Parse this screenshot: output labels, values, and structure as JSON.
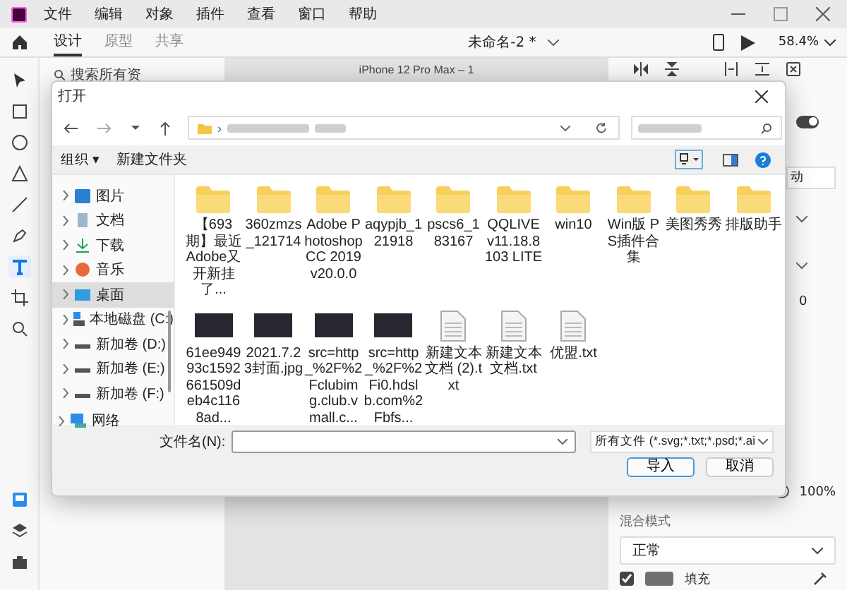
{
  "app": {
    "menu": [
      "文件",
      "编辑",
      "对象",
      "插件",
      "查看",
      "窗口",
      "帮助"
    ],
    "tabs": [
      {
        "label": "设计",
        "selected": true
      },
      {
        "label": "原型",
        "selected": false
      },
      {
        "label": "共享",
        "selected": false
      }
    ],
    "document_title": "未命名-2 *",
    "zoom": "58.4%",
    "tools": [
      {
        "kind": "select",
        "selected": false
      },
      {
        "kind": "rect",
        "selected": false
      },
      {
        "kind": "ellipse",
        "selected": false
      },
      {
        "kind": "triangle",
        "selected": false
      },
      {
        "kind": "line",
        "selected": false
      },
      {
        "kind": "pen",
        "selected": false
      },
      {
        "kind": "text",
        "selected": true
      },
      {
        "kind": "artboard",
        "selected": false
      },
      {
        "kind": "zoom",
        "selected": false
      }
    ],
    "assets_search": {
      "placeholder": "搜索所有资"
    },
    "artboard_label": "iPhone 12 Pro Max – 1",
    "right_panel": {
      "toggle_on": true,
      "field_fragment": "动",
      "value_fragment": "0",
      "opacity": "100%",
      "opacity_slider": {
        "level": 1
      },
      "blend_label": "混合模式",
      "blend_value": "正常",
      "fill_checked": true,
      "fill_label": "填充"
    }
  },
  "dialog": {
    "title": "打开",
    "organize": "组织 ▾",
    "new_folder": "新建文件夹",
    "nav": [
      {
        "label": "图片",
        "kind": "pictures",
        "selected": false
      },
      {
        "label": "文档",
        "kind": "documents",
        "selected": false
      },
      {
        "label": "下载",
        "kind": "downloads",
        "selected": false
      },
      {
        "label": "音乐",
        "kind": "music",
        "selected": false
      },
      {
        "label": "桌面",
        "kind": "desktop",
        "selected": true
      },
      {
        "label": "本地磁盘 (C:)",
        "kind": "system-drive",
        "selected": false
      },
      {
        "label": "新加卷 (D:)",
        "kind": "drive",
        "selected": false
      },
      {
        "label": "新加卷 (E:)",
        "kind": "drive",
        "selected": false
      },
      {
        "label": "新加卷 (F:)",
        "kind": "drive",
        "selected": false
      }
    ],
    "network": {
      "label": "网络",
      "selected": false
    },
    "files": [
      {
        "name": "【693期】最近Adobe又开新挂了...",
        "kind": "folder"
      },
      {
        "name": "360zmzs_121714",
        "kind": "folder"
      },
      {
        "name": "Adobe Photoshop CC 2019 v20.0.0",
        "kind": "folder"
      },
      {
        "name": "aqypjb_121918",
        "kind": "folder"
      },
      {
        "name": "pscs6_183167",
        "kind": "folder"
      },
      {
        "name": "QQLIVE v11.18.8103 LITE",
        "kind": "folder"
      },
      {
        "name": "win10",
        "kind": "folder"
      },
      {
        "name": "Win版 PS插件合集",
        "kind": "folder"
      },
      {
        "name": "美图秀秀",
        "kind": "folder"
      },
      {
        "name": "排版助手",
        "kind": "folder"
      },
      {
        "name": "61ee94993c1592661509deb4c1168ad...",
        "kind": "image"
      },
      {
        "name": "2021.7.23封面.jpg",
        "kind": "image"
      },
      {
        "name": "src=http_%2F%2Fclubimg.club.vmall.c...",
        "kind": "image"
      },
      {
        "name": "src=http_%2F%2Fi0.hdslb.com%2Fbfs...",
        "kind": "image"
      },
      {
        "name": "新建文本文档 (2).txt",
        "kind": "text"
      },
      {
        "name": "新建文本文档.txt",
        "kind": "text"
      },
      {
        "name": "优盟.txt",
        "kind": "text"
      }
    ],
    "address_separator": "›",
    "filename_label": "文件名(N):",
    "filter": "所有文件 (*.svg;*.txt;*.psd;*.ai",
    "buttons": [
      {
        "label": "导入",
        "kind": "primary"
      },
      {
        "label": "取消",
        "kind": "secondary"
      }
    ]
  }
}
